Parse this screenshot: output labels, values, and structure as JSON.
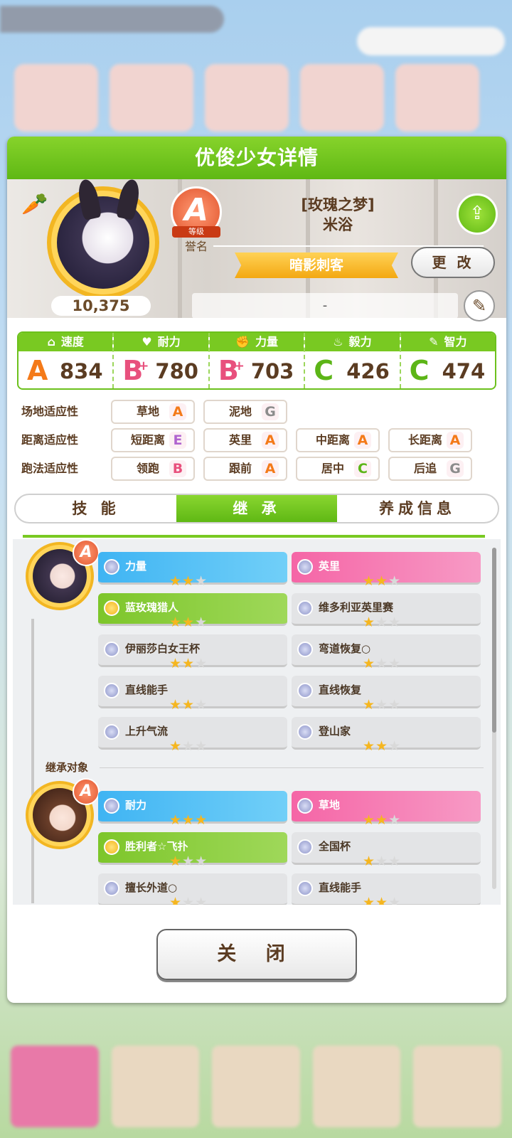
{
  "modal": {
    "title": "优俊少女详情",
    "fans": "10,375",
    "rank": {
      "grade": "A",
      "tag": "等级",
      "name": "誉名"
    },
    "name_line1": "[玫瑰之梦]",
    "name_line2": "米浴",
    "title_ribbon": "暗影刺客",
    "change_label": "更 改",
    "comment": "-"
  },
  "stats": [
    {
      "icon": "⌂",
      "label": "速度",
      "grade": "A",
      "plus": "",
      "value": "834",
      "gc": "gA"
    },
    {
      "icon": "♥",
      "label": "耐力",
      "grade": "B",
      "plus": "+",
      "value": "780",
      "gc": "gB"
    },
    {
      "icon": "✊",
      "label": "力量",
      "grade": "B",
      "plus": "+",
      "value": "703",
      "gc": "gB"
    },
    {
      "icon": "♨",
      "label": "毅力",
      "grade": "C",
      "plus": "",
      "value": "426",
      "gc": "gC"
    },
    {
      "icon": "✎",
      "label": "智力",
      "grade": "C",
      "plus": "",
      "value": "474",
      "gc": "gC"
    }
  ],
  "aptitude": {
    "track": {
      "label": "场地适应性",
      "items": [
        {
          "name": "草地",
          "grade": "A"
        },
        {
          "name": "泥地",
          "grade": "G"
        }
      ]
    },
    "distance": {
      "label": "距离适应性",
      "items": [
        {
          "name": "短距离",
          "grade": "E"
        },
        {
          "name": "英里",
          "grade": "A"
        },
        {
          "name": "中距离",
          "grade": "A"
        },
        {
          "name": "长距离",
          "grade": "A"
        }
      ]
    },
    "style": {
      "label": "跑法适应性",
      "items": [
        {
          "name": "领跑",
          "grade": "B"
        },
        {
          "name": "跟前",
          "grade": "A"
        },
        {
          "name": "居中",
          "grade": "C"
        },
        {
          "name": "后追",
          "grade": "G"
        }
      ]
    }
  },
  "tabs": [
    "技 能",
    "继 承",
    "养成信息"
  ],
  "active_tab": 1,
  "inheritance": {
    "parent1": {
      "rank": "A",
      "factors": [
        {
          "name": "力量",
          "stars": 2,
          "color": "blue"
        },
        {
          "name": "英里",
          "stars": 2,
          "color": "pink"
        },
        {
          "name": "蓝玫瑰猎人",
          "stars": 2,
          "color": "green"
        },
        {
          "name": "维多利亚英里赛",
          "stars": 1,
          "color": "white"
        },
        {
          "name": "伊丽莎白女王杯",
          "stars": 2,
          "color": "white"
        },
        {
          "name": "弯道恢复○",
          "stars": 1,
          "color": "white"
        },
        {
          "name": "直线能手",
          "stars": 2,
          "color": "white"
        },
        {
          "name": "直线恢复",
          "stars": 1,
          "color": "white"
        },
        {
          "name": "上升气流",
          "stars": 1,
          "color": "white"
        },
        {
          "name": "登山家",
          "stars": 2,
          "color": "white"
        }
      ]
    },
    "section_label": "继承对象",
    "parent2": {
      "rank": "A",
      "factors": [
        {
          "name": "耐力",
          "stars": 3,
          "color": "blue"
        },
        {
          "name": "草地",
          "stars": 2,
          "color": "pink"
        },
        {
          "name": "胜利者☆飞扑",
          "stars": 1,
          "color": "green"
        },
        {
          "name": "全国杯",
          "stars": 1,
          "color": "white"
        },
        {
          "name": "擅长外道○",
          "stars": 1,
          "color": "white"
        },
        {
          "name": "直线能手",
          "stars": 2,
          "color": "white"
        }
      ]
    }
  },
  "close_label": "关 闭"
}
